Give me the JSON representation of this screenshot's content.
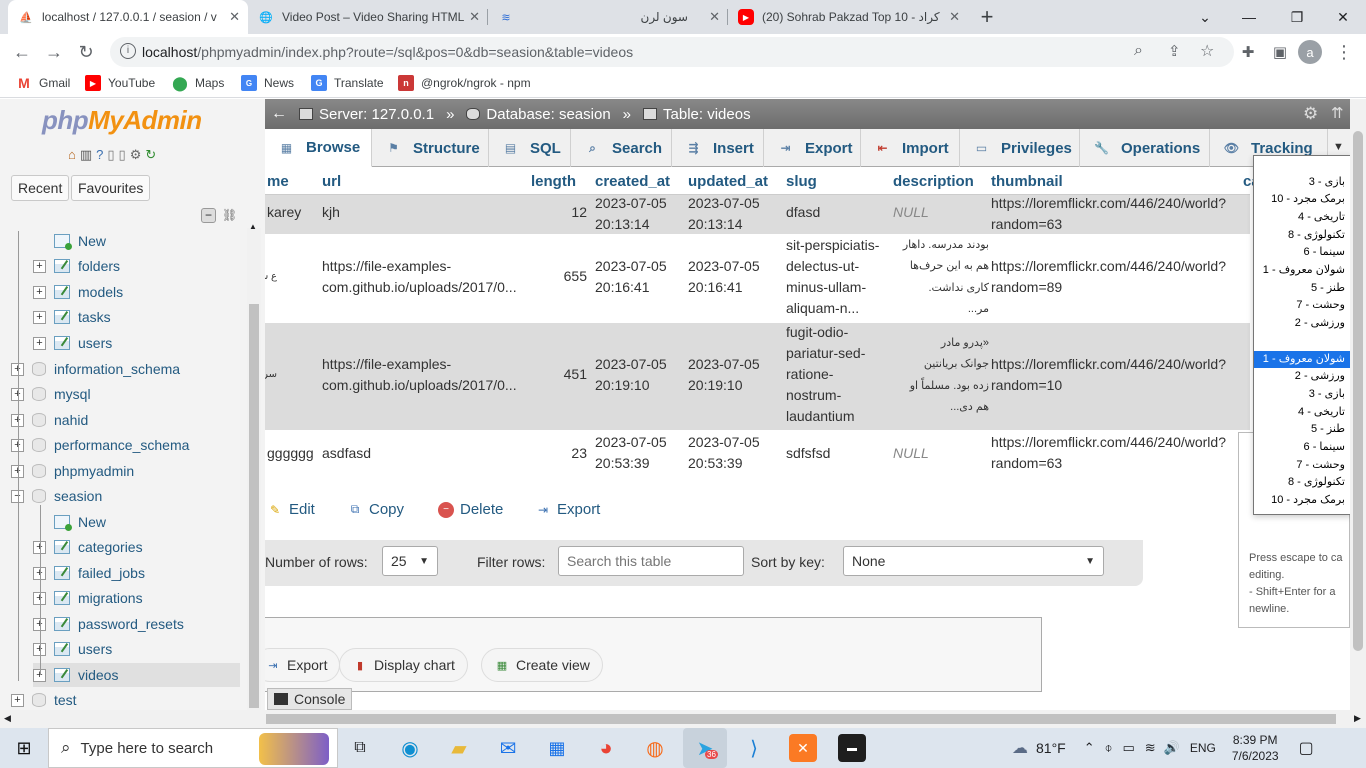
{
  "browser": {
    "tabs": [
      {
        "title": "localhost / 127.0.0.1 / seasion / v",
        "active": true
      },
      {
        "title": "Video Post – Video Sharing HTML",
        "active": false
      },
      {
        "title": "",
        "active": false
      },
      {
        "title": "سون لرن",
        "active": false
      },
      {
        "title": "(20) Sohrab Pakzad Top 10 - کراد",
        "active": false
      }
    ],
    "new_tab": "+",
    "url_host": "localhost",
    "url_path": "/phpmyadmin/index.php?route=/sql&pos=0&db=seasion&table=videos",
    "profile_initial": "a",
    "bookmarks": [
      "Gmail",
      "YouTube",
      "Maps",
      "News",
      "Translate",
      "@ngrok/ngrok - npm"
    ]
  },
  "sidebar": {
    "logo_php": "php",
    "logo_my": "MyAdmin",
    "recent": "Recent",
    "favourites": "Favourites",
    "tree": [
      {
        "label": "New",
        "level": 2,
        "kind": "new"
      },
      {
        "label": "folders",
        "level": 2,
        "kind": "table"
      },
      {
        "label": "models",
        "level": 2,
        "kind": "table"
      },
      {
        "label": "tasks",
        "level": 2,
        "kind": "table"
      },
      {
        "label": "users",
        "level": 2,
        "kind": "table"
      },
      {
        "label": "information_schema",
        "level": 1,
        "kind": "db"
      },
      {
        "label": "mysql",
        "level": 1,
        "kind": "db"
      },
      {
        "label": "nahid",
        "level": 1,
        "kind": "db"
      },
      {
        "label": "performance_schema",
        "level": 1,
        "kind": "db"
      },
      {
        "label": "phpmyadmin",
        "level": 1,
        "kind": "db"
      },
      {
        "label": "seasion",
        "level": 1,
        "kind": "db-open"
      },
      {
        "label": "New",
        "level": 2,
        "kind": "new"
      },
      {
        "label": "categories",
        "level": 2,
        "kind": "table"
      },
      {
        "label": "failed_jobs",
        "level": 2,
        "kind": "table"
      },
      {
        "label": "migrations",
        "level": 2,
        "kind": "table"
      },
      {
        "label": "password_resets",
        "level": 2,
        "kind": "table"
      },
      {
        "label": "users",
        "level": 2,
        "kind": "table"
      },
      {
        "label": "videos",
        "level": 2,
        "kind": "table-selected"
      },
      {
        "label": "test",
        "level": 1,
        "kind": "db"
      }
    ]
  },
  "breadcrumb": {
    "server": "Server: 127.0.0.1",
    "database": "Database: seasion",
    "table": "Table: videos",
    "sep": "»"
  },
  "tabs": [
    {
      "label": "Browse",
      "icon": "▦"
    },
    {
      "label": "Structure",
      "icon": "⚑"
    },
    {
      "label": "SQL",
      "icon": "▤"
    },
    {
      "label": "Search",
      "icon": "⌕"
    },
    {
      "label": "Insert",
      "icon": "⇶"
    },
    {
      "label": "Export",
      "icon": "⇥"
    },
    {
      "label": "Import",
      "icon": "⇤"
    },
    {
      "label": "Privileges",
      "icon": "▭"
    },
    {
      "label": "Operations",
      "icon": "🔧"
    },
    {
      "label": "Tracking",
      "icon": "👁"
    }
  ],
  "columns": [
    "me",
    "url",
    "length",
    "created_at",
    "updated_at",
    "slug",
    "description",
    "thumbnail",
    "ca"
  ],
  "rows": [
    {
      "name": "karey",
      "url": "kjh",
      "length": "12",
      "created": [
        "2023-07-05",
        "20:13:14"
      ],
      "updated": [
        "2023-07-05",
        "20:13:14"
      ],
      "slug": [
        "dfasd"
      ],
      "description": [
        "NULL"
      ],
      "desc_null": true,
      "thumb": [
        "https://loremflickr.com/446/240/world?",
        "random=63"
      ]
    },
    {
      "name": "ع سبزوا",
      "url": "https://file-examples-\ncom.github.io/uploads/2017/0...",
      "length": "655",
      "created": [
        "2023-07-05",
        "20:16:41"
      ],
      "updated": [
        "2023-07-05",
        "20:16:41"
      ],
      "slug": [
        "sit-perspiciatis-",
        "delectus-ut-",
        "minus-ullam-",
        "aliquam-n..."
      ],
      "description": [
        "بودند مدرسه. داهار",
        "هم به این حرف‌ها",
        "کاری نداشت.",
        "مر..."
      ],
      "desc_null": false,
      "thumb": [
        "https://loremflickr.com/446/240/world?",
        "random=89"
      ]
    },
    {
      "name": "سرود بخ",
      "url": "https://file-examples-\ncom.github.io/uploads/2017/0...",
      "length": "451",
      "created": [
        "2023-07-05",
        "20:19:10"
      ],
      "updated": [
        "2023-07-05",
        "20:19:10"
      ],
      "slug": [
        "fugit-odio-",
        "pariatur-sed-",
        "ratione-",
        "nostrum-",
        "laudantium"
      ],
      "description": [
        "«پدرو مادر",
        "جوانک بریانتین",
        "زده بود. مسلماً او",
        "هم دی..."
      ],
      "desc_null": false,
      "thumb": [
        "https://loremflickr.com/446/240/world?",
        "random=10"
      ]
    },
    {
      "name": "gggggg",
      "url": "asdfasd",
      "length": "23",
      "created": [
        "2023-07-05",
        "20:53:39"
      ],
      "updated": [
        "2023-07-05",
        "20:53:39"
      ],
      "slug": [
        "sdfsfsd"
      ],
      "description": [
        "NULL"
      ],
      "desc_null": true,
      "thumb": [
        "https://loremflickr.com/446/240/world?",
        "random=63"
      ]
    }
  ],
  "row_actions": [
    "Edit",
    "Copy",
    "Delete",
    "Export"
  ],
  "nav": {
    "rows_label": "Number of rows:",
    "rows_value": "25",
    "filter_label": "Filter rows:",
    "filter_placeholder": "Search this table",
    "sort_label": "Sort by key:",
    "sort_value": "None"
  },
  "query_ops": [
    "Export",
    "Display chart",
    "Create view"
  ],
  "console": "Console",
  "dropdown": {
    "options": [
      "بازی - 3",
      "برمک مجرد - 10",
      "تاریخی - 4",
      "تکنولوژی - 8",
      "سینما - 6",
      "شولان معروف - 1",
      "طنز - 5",
      "وحشت - 7",
      "ورزشی - 2",
      "",
      "شولان معروف - 1",
      "ورزشی - 2",
      "بازی - 3",
      "تاریخی - 4",
      "طنز - 5",
      "سینما - 6",
      "وحشت - 7",
      "تکنولوژی - 8",
      "برمک مجرد - 10"
    ],
    "highlighted_index": 10
  },
  "edit_hint": [
    "Press escape to ca",
    "editing.",
    "- Shift+Enter for a",
    "newline."
  ],
  "taskbar": {
    "search_placeholder": "Type here to search",
    "weather": "81°F",
    "lang": "ENG",
    "time": "8:39 PM",
    "date": "7/6/2023",
    "telegram_badge": "36"
  },
  "colors": {
    "pma_link": "#235a81",
    "selection": "#1a73e8",
    "youtube": "#ff0000"
  }
}
